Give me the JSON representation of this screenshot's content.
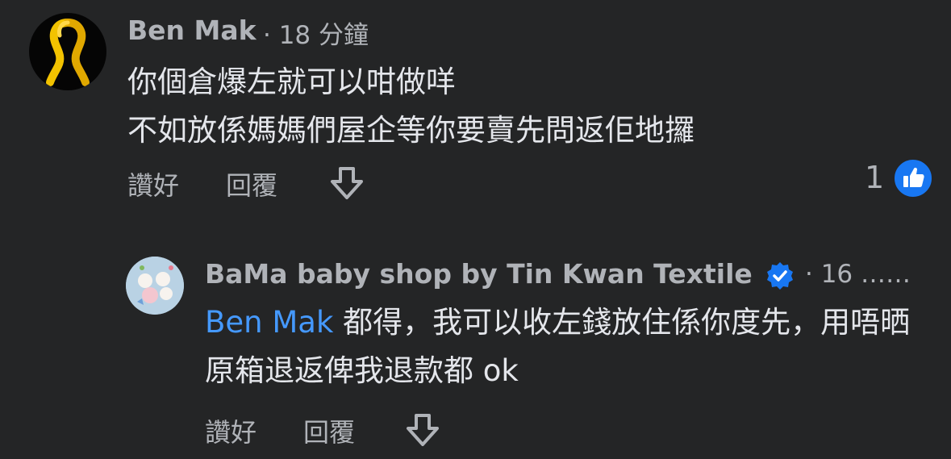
{
  "colors": {
    "background": "#242526",
    "text_primary": "#e4e6eb",
    "text_secondary": "#b0b3b8",
    "mention": "#4599ff",
    "accent_blue": "#1877f2",
    "ribbon_yellow": "#f2c200"
  },
  "comment": {
    "author": "Ben Mak",
    "meta": "· 18 分鐘",
    "lines": [
      "你個倉爆左就可以咁做咩",
      "不如放係媽媽們屋企等你要賣先問返佢地攞"
    ],
    "actions": {
      "like_label": "讚好",
      "reply_label": "回覆",
      "download_icon": "download-arrow-icon"
    },
    "reaction_count": "1",
    "reaction_icon": "thumbs-up-icon",
    "avatar_icon": "yellow-ribbon-icon"
  },
  "reply": {
    "author": "BaMa baby shop by Tin Kwan Textile",
    "verified_icon": "verified-badge-icon",
    "meta": "· 16 ……",
    "mention": "Ben Mak",
    "text": " 都得，我可以收左錢放住係你度先，用唔晒原箱退返俾我退款都 ok",
    "avatar_label": "BaMa baby shop",
    "actions": {
      "like_label": "讚好",
      "reply_label": "回覆",
      "download_icon": "download-arrow-icon"
    }
  }
}
